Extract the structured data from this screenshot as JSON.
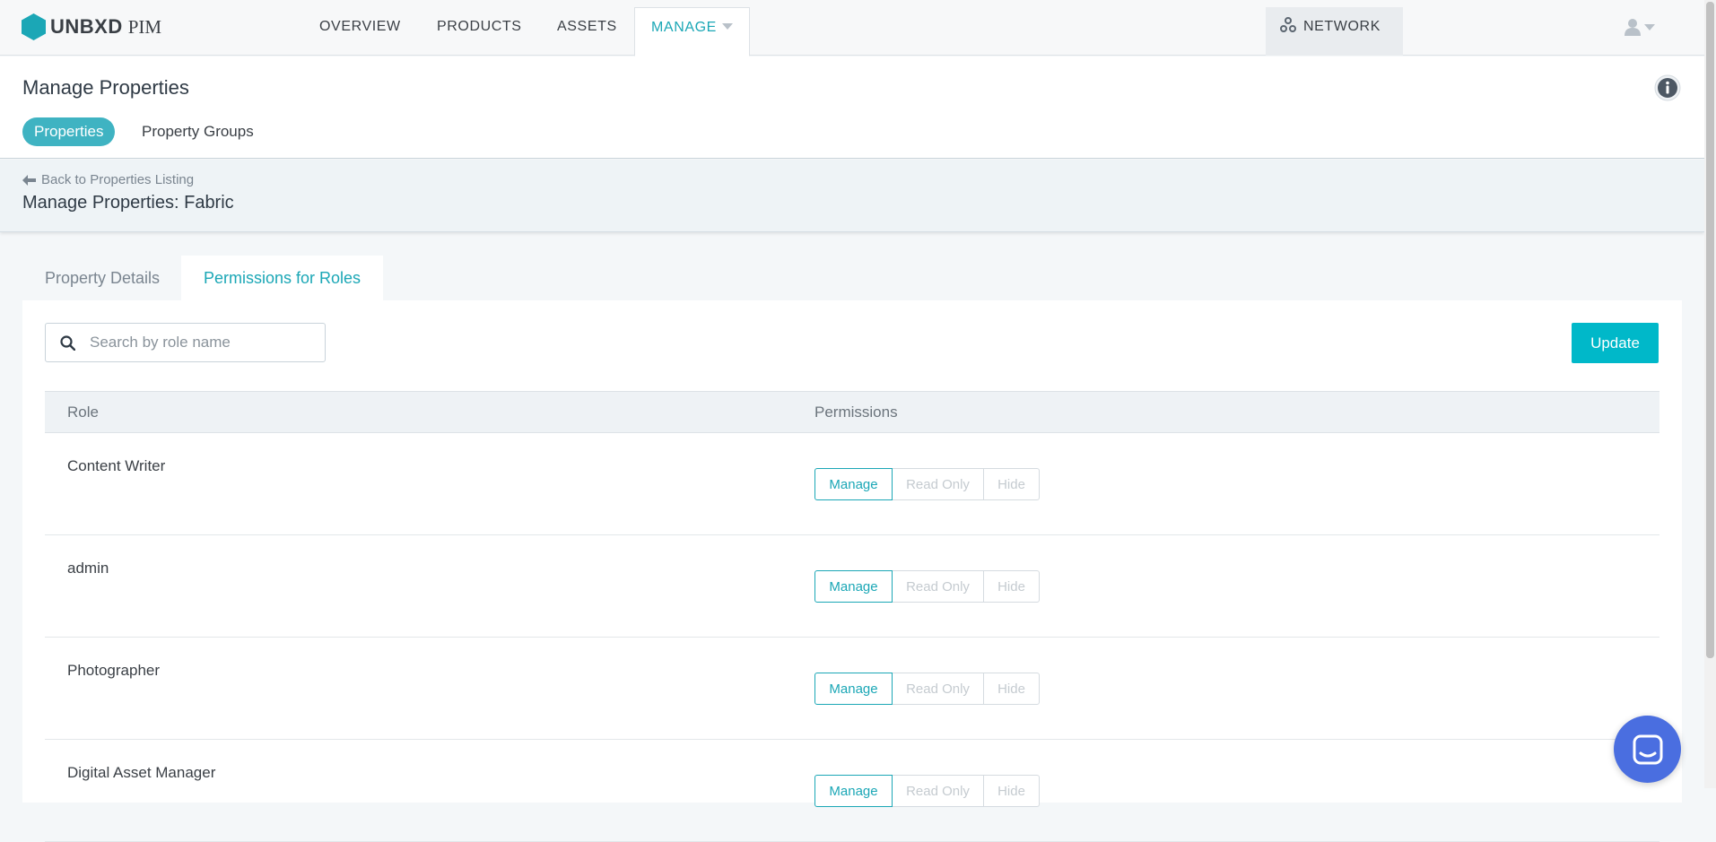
{
  "app": {
    "brand": "UNBXD",
    "product": "PIM"
  },
  "nav": {
    "items": [
      {
        "label": "OVERVIEW"
      },
      {
        "label": "PRODUCTS"
      },
      {
        "label": "ASSETS"
      },
      {
        "label": "MANAGE"
      }
    ],
    "network_label": "NETWORK"
  },
  "header": {
    "title": "Manage Properties",
    "tabs": [
      {
        "label": "Properties",
        "active": true
      },
      {
        "label": "Property Groups",
        "active": false
      }
    ]
  },
  "breadcrumb": {
    "back_label": "Back to Properties Listing",
    "subtitle": "Manage Properties: Fabric"
  },
  "detail_tabs": [
    {
      "label": "Property Details",
      "active": false
    },
    {
      "label": "Permissions for Roles",
      "active": true
    }
  ],
  "search": {
    "placeholder": "Search by role name",
    "value": ""
  },
  "update_label": "Update",
  "table": {
    "columns": [
      "Role",
      "Permissions"
    ],
    "permission_options": [
      "Manage",
      "Read Only",
      "Hide"
    ],
    "rows": [
      {
        "role": "Content Writer",
        "selected": "Manage"
      },
      {
        "role": "admin",
        "selected": "Manage"
      },
      {
        "role": "Photographer",
        "selected": "Manage"
      },
      {
        "role": "Digital Asset Manager",
        "selected": "Manage"
      }
    ]
  },
  "colors": {
    "accent": "#1ba7b6",
    "pill_active": "#3fb3c2",
    "update_button": "#00b8c9",
    "chat_launcher": "#4a6ee0"
  },
  "icons": {
    "logo": "hexagon-logo-icon",
    "network": "network-icon",
    "user": "user-icon",
    "info": "info-icon",
    "back": "arrow-left-icon",
    "search": "search-icon",
    "chat": "chat-icon"
  }
}
